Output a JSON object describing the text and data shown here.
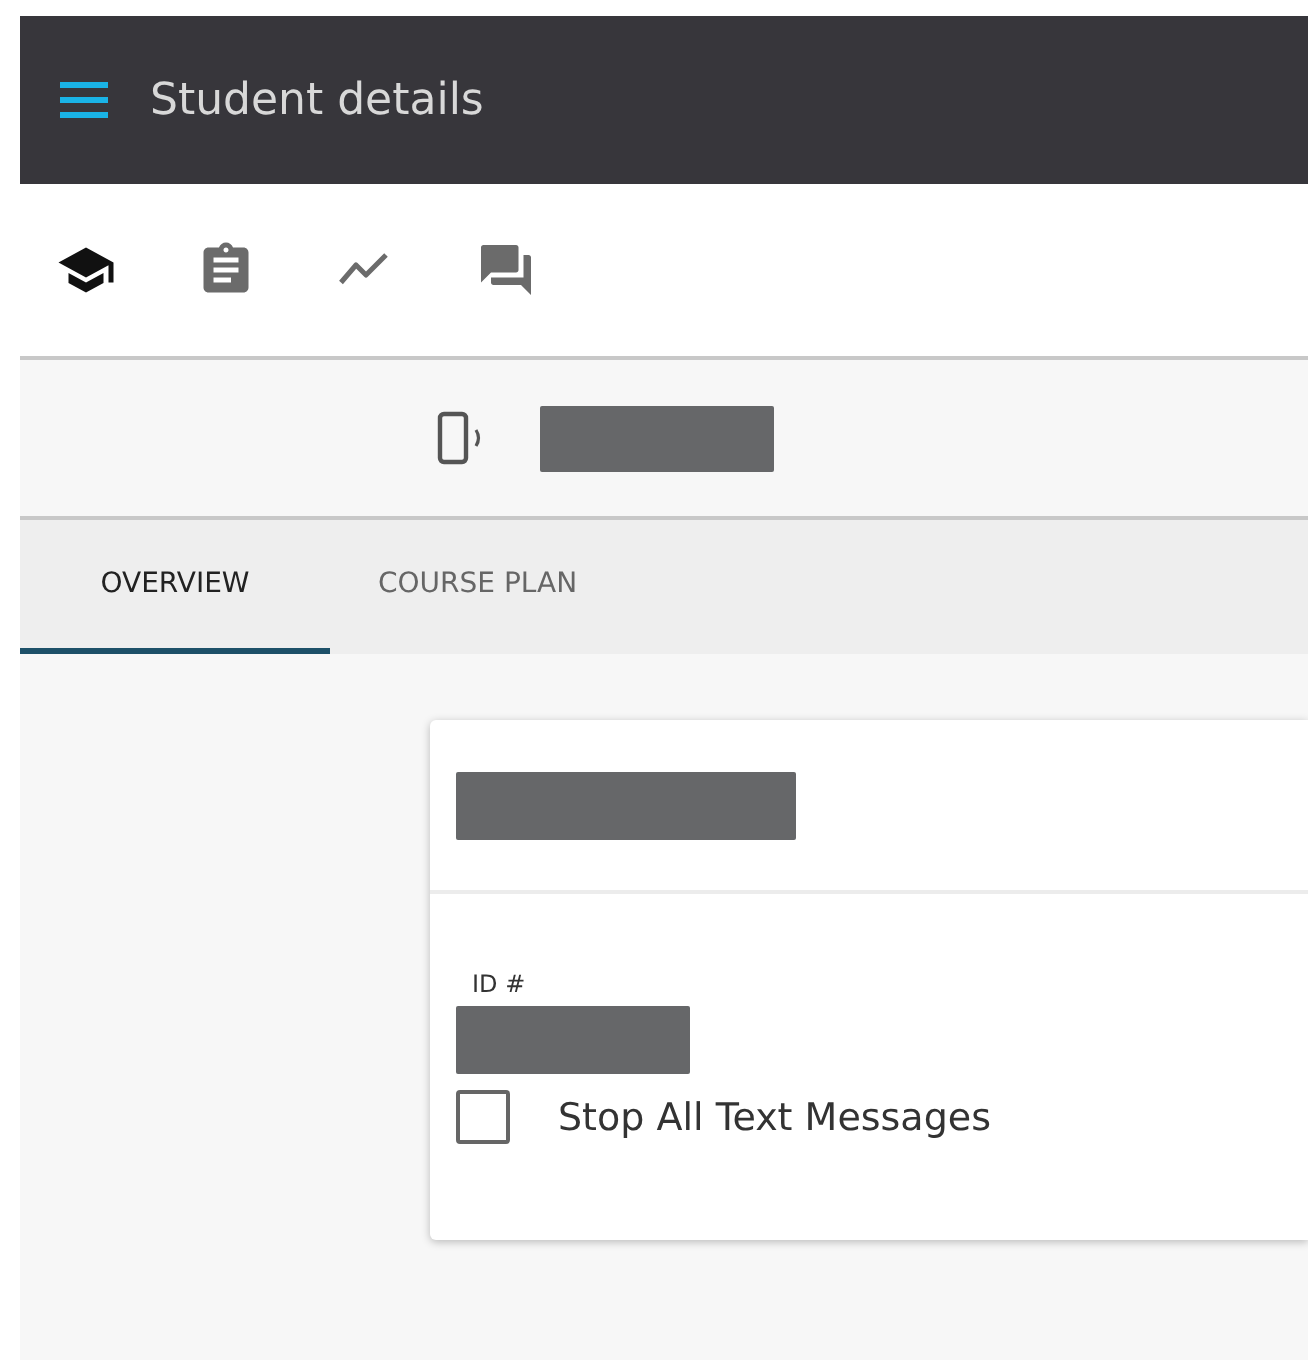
{
  "app_bar": {
    "title": "Student details"
  },
  "toolbar": [
    {
      "kind": "school",
      "selected": true
    },
    {
      "kind": "clipboard",
      "selected": false
    },
    {
      "kind": "trend",
      "selected": false
    },
    {
      "kind": "chat",
      "selected": false
    }
  ],
  "tabs": [
    {
      "label": "OVERVIEW",
      "selected": true
    },
    {
      "label": "COURSE PLAN",
      "selected": false
    }
  ],
  "card": {
    "id_label": "ID #",
    "checkbox": {
      "label": "Stop All Text Messages",
      "checked": false
    }
  }
}
